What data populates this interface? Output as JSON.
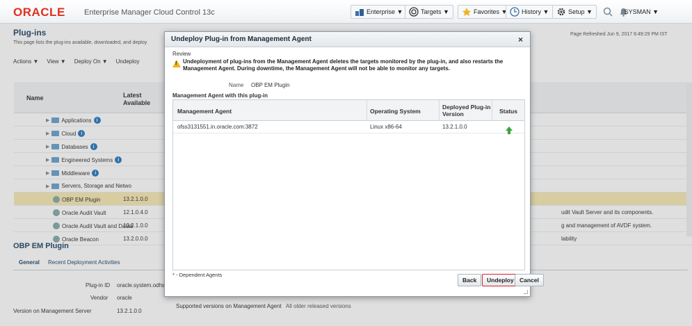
{
  "header": {
    "brand": "ORACLE",
    "product": "Enterprise Manager Cloud Control 13c",
    "nav": [
      "Enterprise ▼",
      "Targets ▼",
      "Favorites ▼",
      "History ▼",
      "Setup ▼"
    ],
    "user": "SYSMAN ▼"
  },
  "page": {
    "title": "Plug-ins",
    "description": "This page lists the plug-ins available, downloaded, and deploy",
    "refreshed": "Page Refreshed Jun 9, 2017 6:49:29 PM IST",
    "toolbar": [
      "Actions ▼",
      "View ▼",
      "Deploy On ▼",
      "Undeploy"
    ],
    "columns": {
      "name": "Name",
      "latest": "Latest Available"
    },
    "rows": [
      {
        "name": "Applications",
        "version": "",
        "desc": "",
        "info": true
      },
      {
        "name": "Cloud",
        "version": "",
        "desc": "",
        "info": true
      },
      {
        "name": "Databases",
        "version": "",
        "desc": "",
        "info": true
      },
      {
        "name": "Engineered Systems",
        "version": "",
        "desc": "",
        "info": true
      },
      {
        "name": "Middleware",
        "version": "",
        "desc": "",
        "info": true
      },
      {
        "name": "Servers, Storage and Netwo",
        "version": "",
        "desc": "",
        "info": false
      },
      {
        "name": "OBP EM Plugin",
        "version": "13.2.1.0.0",
        "desc": "",
        "info": false
      },
      {
        "name": "Oracle Audit Vault",
        "version": "12.1.0.4.0",
        "desc": "udit Vault Server and its components.",
        "info": false
      },
      {
        "name": "Oracle Audit Vault and Datab",
        "version": "13.2.1.0.0",
        "desc": "g and management of AVDF system.",
        "info": false
      },
      {
        "name": "Oracle Beacon",
        "version": "13.2.0.0.0",
        "desc": "lability",
        "info": false
      }
    ]
  },
  "details": {
    "title": "OBP EM Plugin",
    "tabs": [
      "General",
      "Recent Deployment Activities"
    ],
    "plugin_id_label": "Plug-in ID",
    "plugin_id_value": "oracle.system.odhs",
    "vendor_label": "Vendor",
    "vendor_value": "oracle",
    "version_label": "Version on Management Server",
    "version_value": "13.2.1.0.0",
    "supported_label": "Supported versions on Management Agent",
    "supported_value": "All older released versions"
  },
  "dialog": {
    "title": "Undeploy Plug-in from Management Agent",
    "close": "×",
    "review": "Review",
    "warning": "Undeployment of plug-ins from the Management Agent deletes the targets monitored by the plug-in, and also restarts the Management Agent. During downtime, the Management Agent will not be able to monitor any targets.",
    "name_label": "Name",
    "name_value": "OBP EM Plugin",
    "section": "Management Agent with this plug-in",
    "columns": {
      "agent": "Management Agent",
      "os": "Operating System",
      "deployed": "Deployed Plug-in Version",
      "status": "Status"
    },
    "rows": [
      {
        "agent": "ofss3131551.in.oracle.com:3872",
        "os": "Linux x86-64",
        "deployed": "13.2.1.0.0",
        "status": "up"
      }
    ],
    "note": "* - Dependent Agents",
    "buttons": {
      "back": "Back",
      "undeploy": "Undeploy",
      "cancel": "Cancel"
    }
  }
}
